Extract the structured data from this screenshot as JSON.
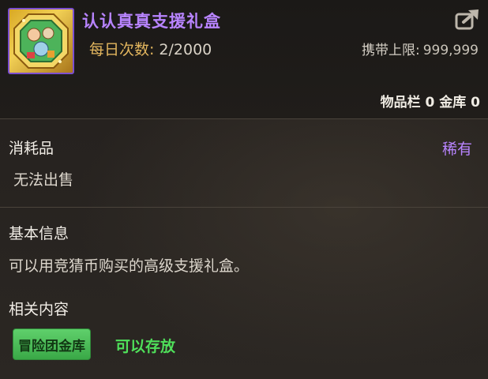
{
  "item": {
    "name": "认认真真支援礼盒",
    "icon": "gift-box-icon",
    "daily_label": "每日次数:",
    "daily_value": "2/2000",
    "carry_label": "携带上限:",
    "carry_value": "999,999",
    "storage_text": "物品栏 0 金库 0"
  },
  "sections": {
    "type_title": "消耗品",
    "rarity": "稀有",
    "sale_note": "无法出售",
    "basic_title": "基本信息",
    "basic_desc": "可以用竞猜币购买的高级支援礼盒。",
    "related_title": "相关内容",
    "related_tag": "冒险团金库",
    "related_note": "可以存放"
  },
  "colors": {
    "rarity_purple": "#b884ff",
    "accent_gold": "#e3b65e",
    "tag_green": "#4fe05a"
  }
}
